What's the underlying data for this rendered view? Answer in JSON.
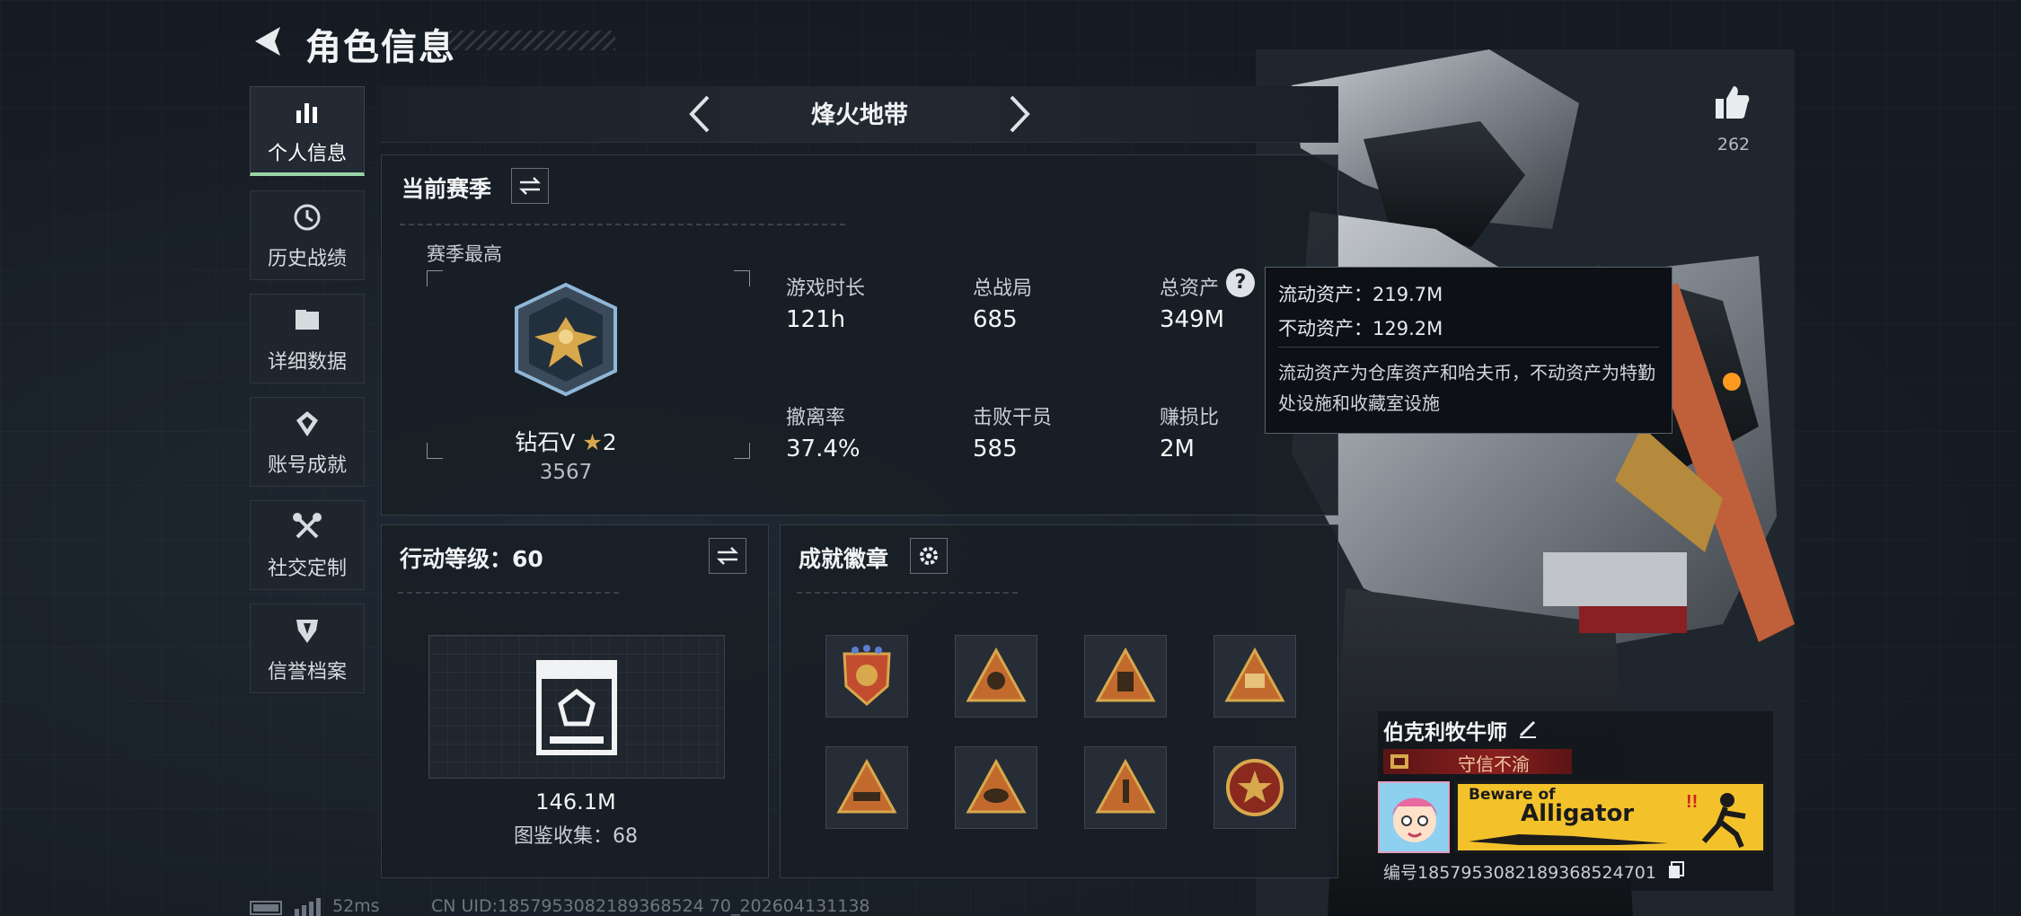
{
  "header": {
    "title": "角色信息"
  },
  "sidebar": {
    "items": [
      {
        "label": "个人信息",
        "icon": "bar-chart-icon",
        "active": true
      },
      {
        "label": "历史战绩",
        "icon": "history-icon"
      },
      {
        "label": "详细数据",
        "icon": "folder-icon"
      },
      {
        "label": "账号成就",
        "icon": "achievement-icon"
      },
      {
        "label": "社交定制",
        "icon": "tools-icon"
      },
      {
        "label": "信誉档案",
        "icon": "credit-shield-icon"
      }
    ]
  },
  "mode": {
    "title": "烽火地带"
  },
  "likes": {
    "count": "262"
  },
  "season": {
    "title": "当前赛季",
    "best_label": "赛季最高",
    "rank_name": "钻石V",
    "rank_stars": "2",
    "rank_score": "3567",
    "stats": [
      {
        "label": "游戏时长",
        "value": "121h"
      },
      {
        "label": "总战局",
        "value": "685"
      },
      {
        "label": "总资产",
        "value": "349M"
      },
      {
        "label": "撤离率",
        "value": "37.4%"
      },
      {
        "label": "击败干员",
        "value": "585"
      },
      {
        "label": "赚损比",
        "value": "2M"
      }
    ]
  },
  "tooltip": {
    "liquid": "流动资产：219.7M",
    "fixed": "不动资产：129.2M",
    "desc": "流动资产为仓库资产和哈夫币，不动资产为特勤处设施和收藏室设施"
  },
  "action_level": {
    "title": "行动等级：60",
    "value": "146.1M",
    "collection": "图鉴收集：68"
  },
  "badges": {
    "title": "成就徽章",
    "tile_count": 8
  },
  "player": {
    "name": "伯克利牧牛师",
    "honor": "守信不渝",
    "banner_line1": "Beware of",
    "banner_line2": "Alligator",
    "id_label": "编号",
    "id": "1857953082189368524701"
  },
  "footer": {
    "ping": "52ms",
    "uid": "CN UID:1857953082189368524 70_202604131138"
  },
  "colors": {
    "accent_green": "#9ad3a8",
    "gold": "#d8a84c",
    "banner_yellow": "#f3c22b",
    "honor_red": "#7a1a1a"
  }
}
